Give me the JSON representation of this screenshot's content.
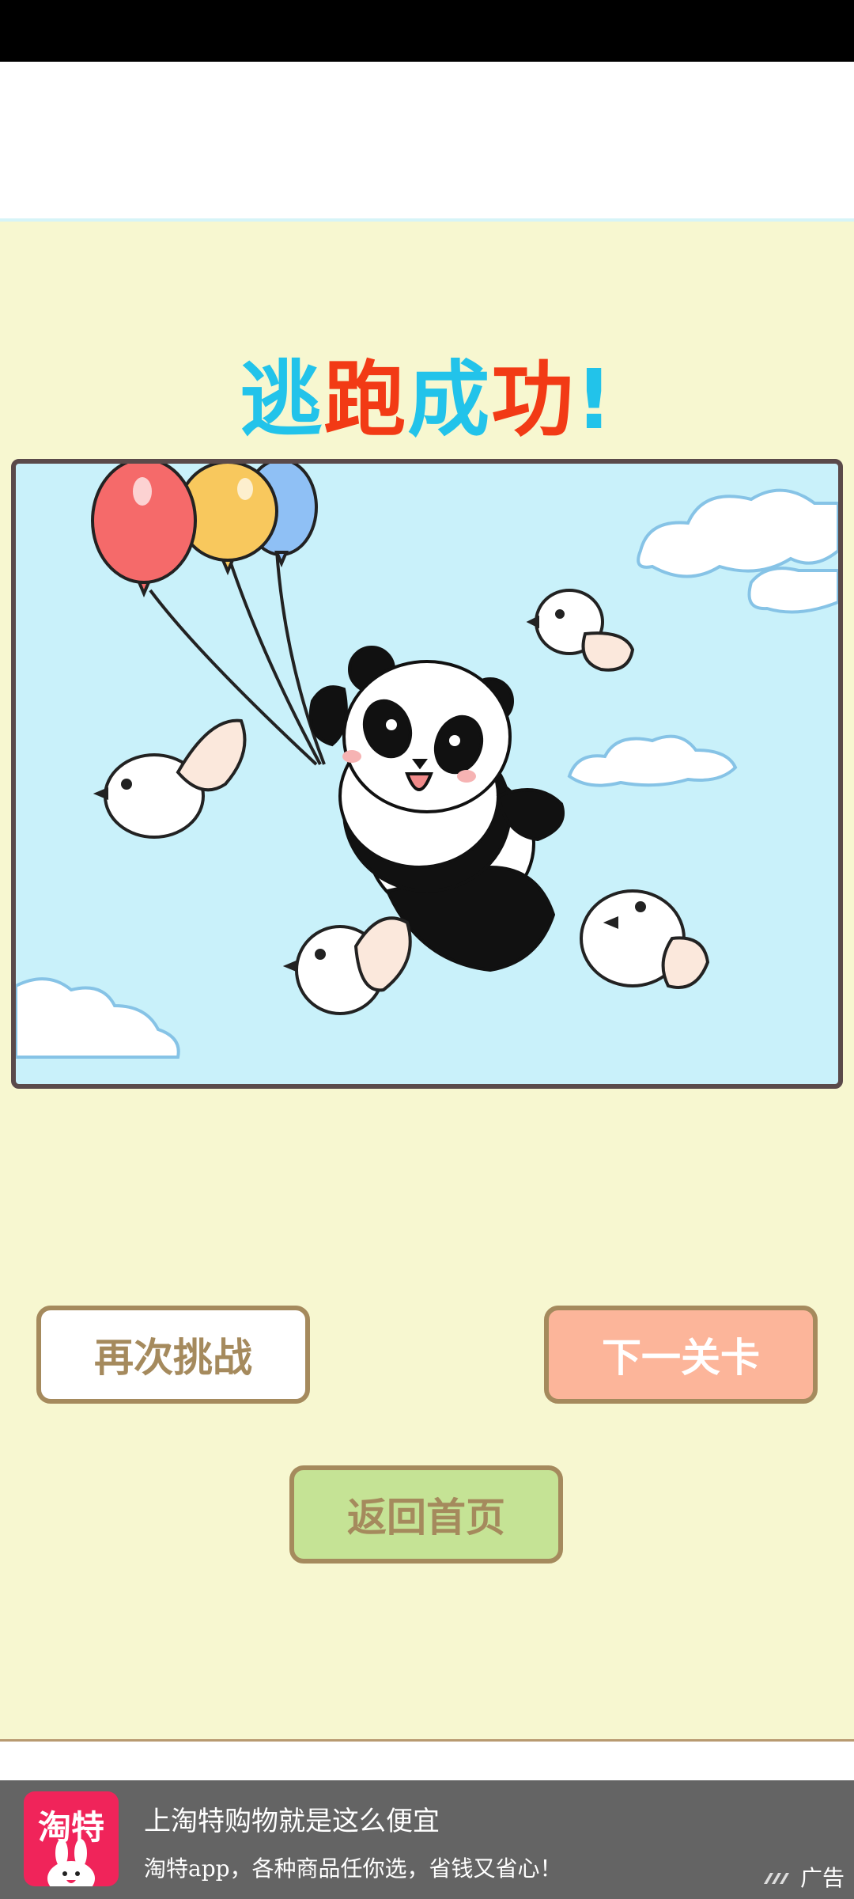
{
  "title": {
    "chars": [
      "逃",
      "跑",
      "成",
      "功",
      "!"
    ],
    "colors": [
      "#22c3ea",
      "#f23a15",
      "#22c3ea",
      "#f23a15",
      "#22c3ea"
    ]
  },
  "scene": {
    "illustration": "panda-with-balloons-and-birds"
  },
  "buttons": {
    "retry": "再次挑战",
    "next": "下一关卡",
    "home": "返回首页"
  },
  "ad": {
    "logo_text": "淘特",
    "title": "上淘特购物就是这么便宜",
    "description": "淘特app，各种商品任你选，省钱又省心！",
    "tag": "广告"
  },
  "colors": {
    "game_bg": "#f7f7d0",
    "button_border": "#a58a5d",
    "next_bg": "#fcb59a",
    "home_bg": "#c5e395",
    "ad_bg": "#646464"
  }
}
